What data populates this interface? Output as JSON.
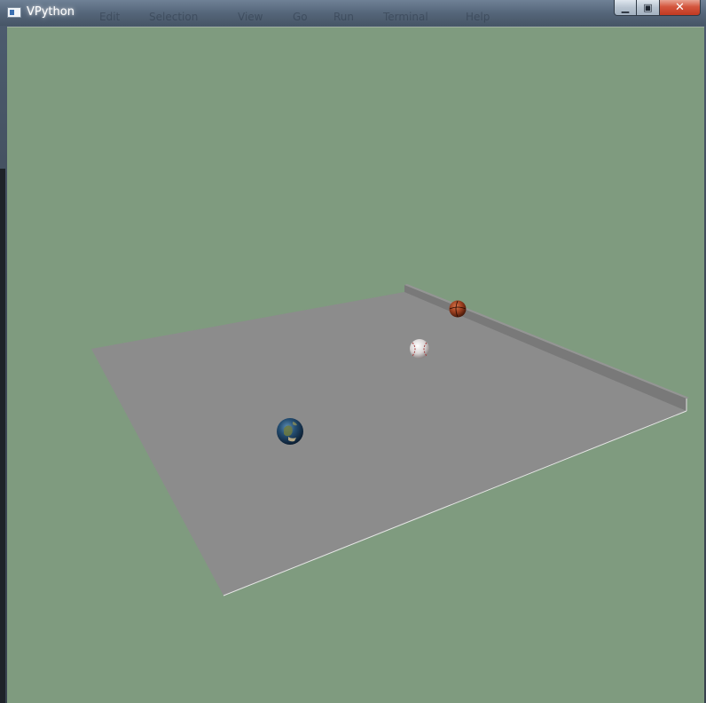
{
  "window": {
    "title": "VPython",
    "ghost_menu_labels": [
      "Edit",
      "Selection",
      "View",
      "Go",
      "Run",
      "Terminal",
      "Help"
    ]
  },
  "controls": {
    "minimize_icon": "minimize-icon",
    "maximize_icon": "maximize-icon",
    "close_icon": "close-icon"
  },
  "scene": {
    "background_color": "#7f9b7f",
    "floor_color": "#8c8c8c",
    "wall_color": "#7a7a7a",
    "objects": [
      {
        "name": "earth-sphere",
        "texture": "earth"
      },
      {
        "name": "baseball-sphere",
        "texture": "baseball"
      },
      {
        "name": "basketball-sphere",
        "texture": "basketball"
      }
    ]
  }
}
